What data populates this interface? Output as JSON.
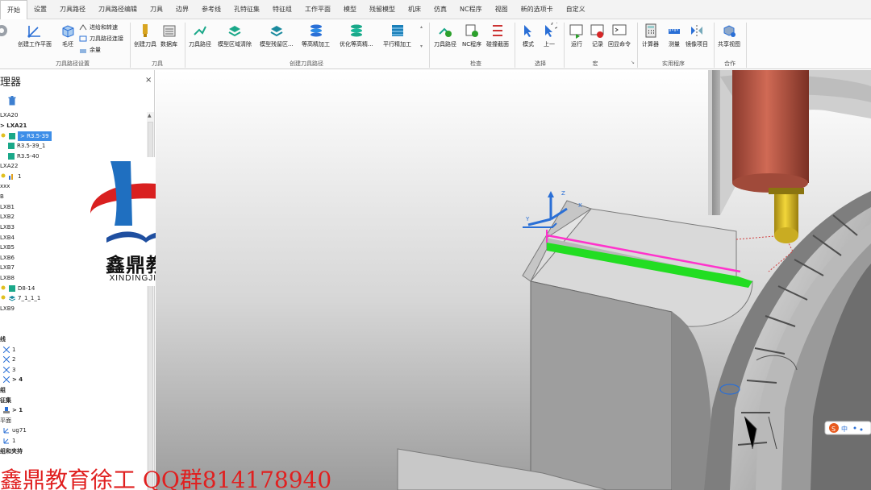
{
  "menu": {
    "tabs": [
      "开始",
      "设置",
      "刀具路径",
      "刀具路径编辑",
      "刀具",
      "边界",
      "参考线",
      "孔特征集",
      "特征组",
      "工作平面",
      "模型",
      "残留模型",
      "机床",
      "仿真",
      "NC程序",
      "视图",
      "新的选项卡",
      "自定义"
    ]
  },
  "ribbon": {
    "buttons": {
      "create_workplane": "创建工作平面",
      "block": "毛坯",
      "leads_links": "进给和转速",
      "toolpath_connect": "刀具路径连接",
      "allowance": "余量",
      "create_tool": "创建刀具",
      "tool_db": "数据库",
      "toolpath": "刀具路径",
      "model_area_clear": "模型区域清除",
      "model_rest_area": "模型残留区...",
      "constant_z_finish": "等高精加工",
      "opt_constant_z": "优化等高精...",
      "raster_finish": "平行精加工",
      "toolpath_check": "刀具路径",
      "nc_program_check": "NC程序",
      "collision_section": "碰撞截面",
      "mode": "模式",
      "previous": "上一",
      "run": "运行",
      "record": "记录",
      "echo_command": "回显命令",
      "calculator": "计算器",
      "measure": "测量",
      "mirror": "镜像项目",
      "share_view": "共享视图"
    },
    "groups": {
      "toolpath_setup": "刀具路径设置",
      "tool": "刀具",
      "create_toolpath": "创建刀具路径",
      "inspect": "检查",
      "select": "选择",
      "macro": "宏",
      "utilities": "实用程序",
      "collaborate": "合作"
    }
  },
  "explorer": {
    "title": "理器",
    "close": "×",
    "rows": [
      "LXA20",
      "> LXA21",
      "> R3.5-39",
      "R3.5-39_1",
      "R3.5-40",
      "LXA22",
      "1",
      "xxx",
      "B",
      "LXB1",
      "LXB2",
      "LXB3",
      "LXB4",
      "LXB5",
      "LXB6",
      "LXB7",
      "LXB8",
      "D8-14",
      "7_1_1_1",
      "LXB9",
      "线",
      "1",
      "2",
      "3",
      "> 4",
      "组",
      "征集",
      "> 1",
      "平面",
      "ug71",
      "1",
      "组和夹持"
    ]
  },
  "logo": {
    "name": "鑫鼎教育",
    "pinyin": "XINDINGJIAOYU"
  },
  "watermark": "鑫鼎教育徐工 QQ群814178940",
  "axes": {
    "x": "X",
    "y": "Y",
    "z": "Z"
  },
  "ime": {
    "lang": "中"
  },
  "colors": {
    "accent": "#3d8ee8",
    "toolpath_pink": "#ff33cc",
    "toolpath_green": "#22dd22",
    "spindle": "#c0604e",
    "tool_tip": "#e0c020",
    "watermark": "#e02020"
  }
}
